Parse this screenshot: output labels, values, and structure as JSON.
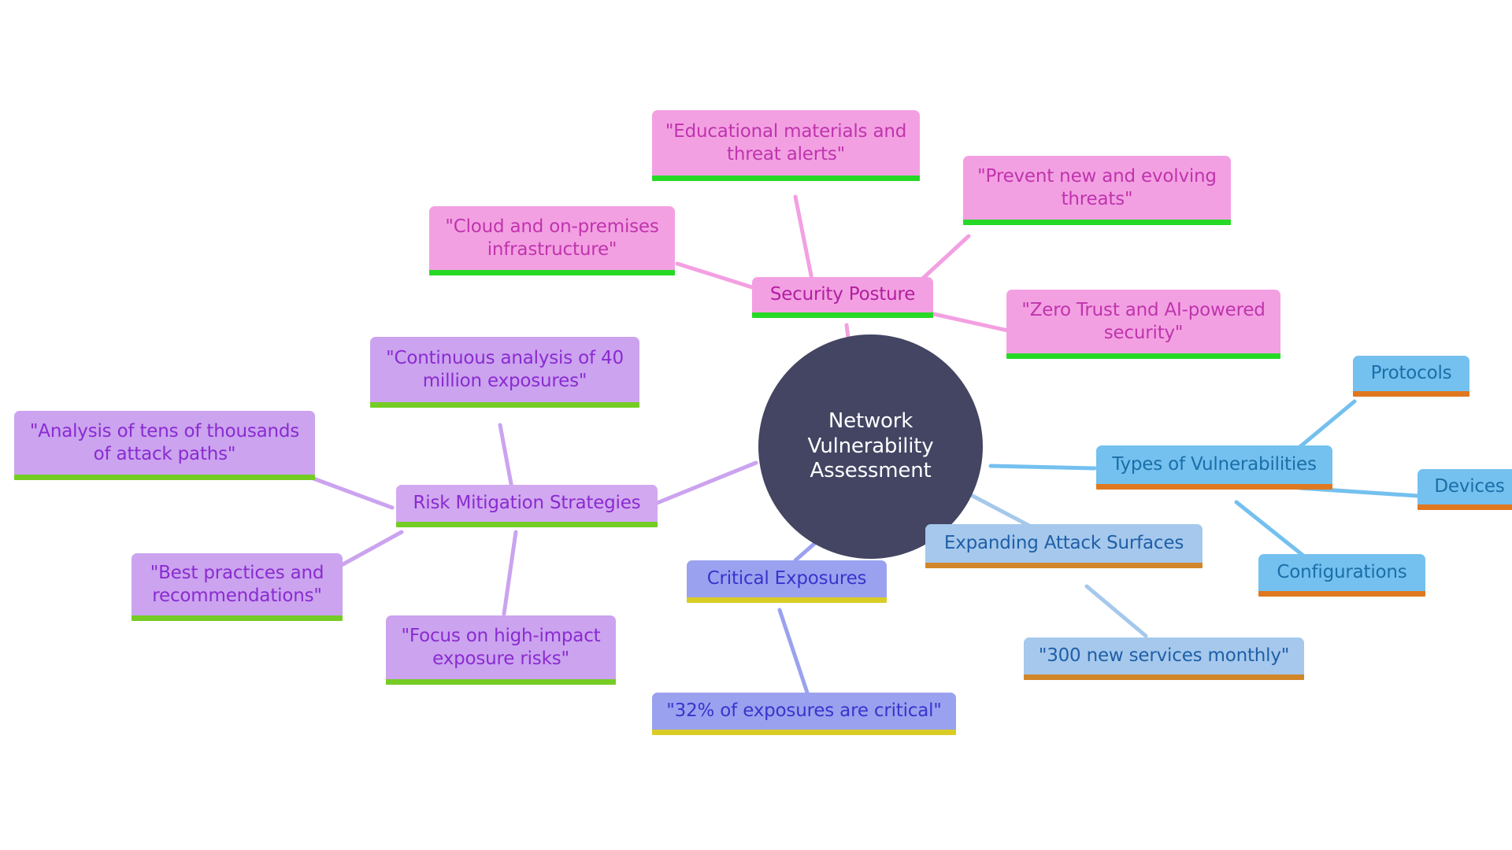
{
  "diagram": {
    "type": "mind-map",
    "title": "Network Vulnerability Assessment",
    "background_color": "#ffffff"
  },
  "root": {
    "label": "Network Vulnerability\nAssessment",
    "fill": "#434563",
    "text_color": "#ffffff"
  },
  "branches": [
    {
      "id": "security-posture",
      "label": "Security Posture",
      "fill": "#f3a0e2",
      "text_color": "#b01fa0",
      "accent": "#26d926",
      "children": [
        {
          "id": "educational-materials",
          "label": "\"Educational materials and\nthreat alerts\""
        },
        {
          "id": "prevent-threats",
          "label": "\"Prevent new and evolving\nthreats\""
        },
        {
          "id": "cloud-on-premises",
          "label": "\"Cloud and on-premises\ninfrastructure\""
        },
        {
          "id": "zero-trust-ai",
          "label": "\"Zero Trust and AI-powered\nsecurity\""
        }
      ]
    },
    {
      "id": "risk-mitigation-strategies",
      "label": "Risk Mitigation Strategies",
      "fill": "#d2a8f0",
      "text_color": "#8a2bd0",
      "accent": "#74cc25",
      "children": [
        {
          "id": "continuous-analysis",
          "label": "\"Continuous analysis of 40\nmillion exposures\""
        },
        {
          "id": "attack-paths-analysis",
          "label": "\"Analysis of tens of thousands\nof attack paths\""
        },
        {
          "id": "best-practices",
          "label": "\"Best practices and\nrecommendations\""
        },
        {
          "id": "high-impact-focus",
          "label": "\"Focus on high-impact\nexposure risks\""
        }
      ]
    },
    {
      "id": "critical-exposures",
      "label": "Critical Exposures",
      "fill": "#9aa2ef",
      "text_color": "#3a33cc",
      "accent": "#d9cc25",
      "children": [
        {
          "id": "exposures-critical-pct",
          "label": "\"32% of exposures are critical\""
        }
      ]
    },
    {
      "id": "types-of-vulnerabilities",
      "label": "Types of Vulnerabilities",
      "fill": "#74c0ef",
      "text_color": "#1a6fa8",
      "accent": "#e07820",
      "children": [
        {
          "id": "protocols",
          "label": "Protocols"
        },
        {
          "id": "devices",
          "label": "Devices"
        },
        {
          "id": "configurations",
          "label": "Configurations"
        }
      ]
    },
    {
      "id": "expanding-attack-surfaces",
      "label": "Expanding Attack Surfaces",
      "fill": "#a5c8ec",
      "text_color": "#1f5fa8",
      "accent": "#d2862a",
      "children": [
        {
          "id": "new-services-monthly",
          "label": "\"300 new services monthly\""
        }
      ]
    }
  ]
}
